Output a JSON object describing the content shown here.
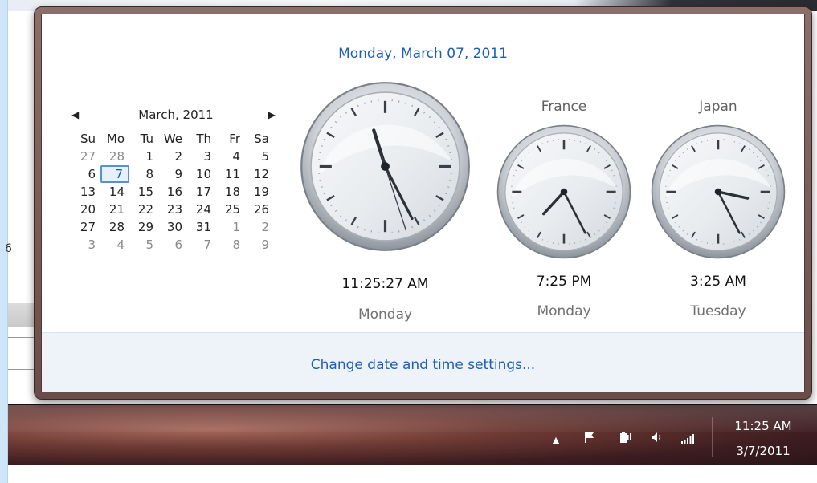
{
  "popup": {
    "full_date": "Monday, March 07, 2011",
    "settings_link": "Change date and time settings..."
  },
  "calendar": {
    "title": "March, 2011",
    "weekdays": [
      "Su",
      "Mo",
      "Tu",
      "We",
      "Th",
      "Fr",
      "Sa"
    ],
    "weeks": [
      [
        {
          "d": "27",
          "dim": true
        },
        {
          "d": "28",
          "dim": true
        },
        {
          "d": "1"
        },
        {
          "d": "2"
        },
        {
          "d": "3"
        },
        {
          "d": "4"
        },
        {
          "d": "5"
        }
      ],
      [
        {
          "d": "6"
        },
        {
          "d": "7",
          "today": true
        },
        {
          "d": "8"
        },
        {
          "d": "9"
        },
        {
          "d": "10"
        },
        {
          "d": "11"
        },
        {
          "d": "12"
        }
      ],
      [
        {
          "d": "13"
        },
        {
          "d": "14"
        },
        {
          "d": "15"
        },
        {
          "d": "16"
        },
        {
          "d": "17"
        },
        {
          "d": "18"
        },
        {
          "d": "19"
        }
      ],
      [
        {
          "d": "20"
        },
        {
          "d": "21"
        },
        {
          "d": "22"
        },
        {
          "d": "23"
        },
        {
          "d": "24"
        },
        {
          "d": "25"
        },
        {
          "d": "26"
        }
      ],
      [
        {
          "d": "27"
        },
        {
          "d": "28"
        },
        {
          "d": "29"
        },
        {
          "d": "30"
        },
        {
          "d": "31"
        },
        {
          "d": "1",
          "dim": true
        },
        {
          "d": "2",
          "dim": true
        }
      ],
      [
        {
          "d": "3",
          "dim": true
        },
        {
          "d": "4",
          "dim": true
        },
        {
          "d": "5",
          "dim": true
        },
        {
          "d": "6",
          "dim": true
        },
        {
          "d": "7",
          "dim": true
        },
        {
          "d": "8",
          "dim": true
        },
        {
          "d": "9",
          "dim": true
        }
      ]
    ],
    "prev_icon": "left-triangle",
    "next_icon": "right-triangle"
  },
  "clocks": {
    "local": {
      "label": "",
      "time": "11:25:27 AM",
      "day": "Monday",
      "h": 11,
      "m": 25,
      "s": 27
    },
    "france": {
      "label": "France",
      "time": "7:25 PM",
      "day": "Monday",
      "h": 19,
      "m": 25,
      "s": 27
    },
    "japan": {
      "label": "Japan",
      "time": "3:25 AM",
      "day": "Tuesday",
      "h": 3,
      "m": 25,
      "s": 27
    }
  },
  "taskbar": {
    "time": "11:25 AM",
    "date": "3/7/2011",
    "icons": [
      "show-hidden-icons-arrow",
      "action-center-flag-icon",
      "power-icon",
      "volume-icon",
      "network-signal-icon"
    ]
  },
  "background": {
    "side_number": "6"
  },
  "colors": {
    "link_blue": "#1e5eb5",
    "today_border": "#5a8fd0"
  }
}
